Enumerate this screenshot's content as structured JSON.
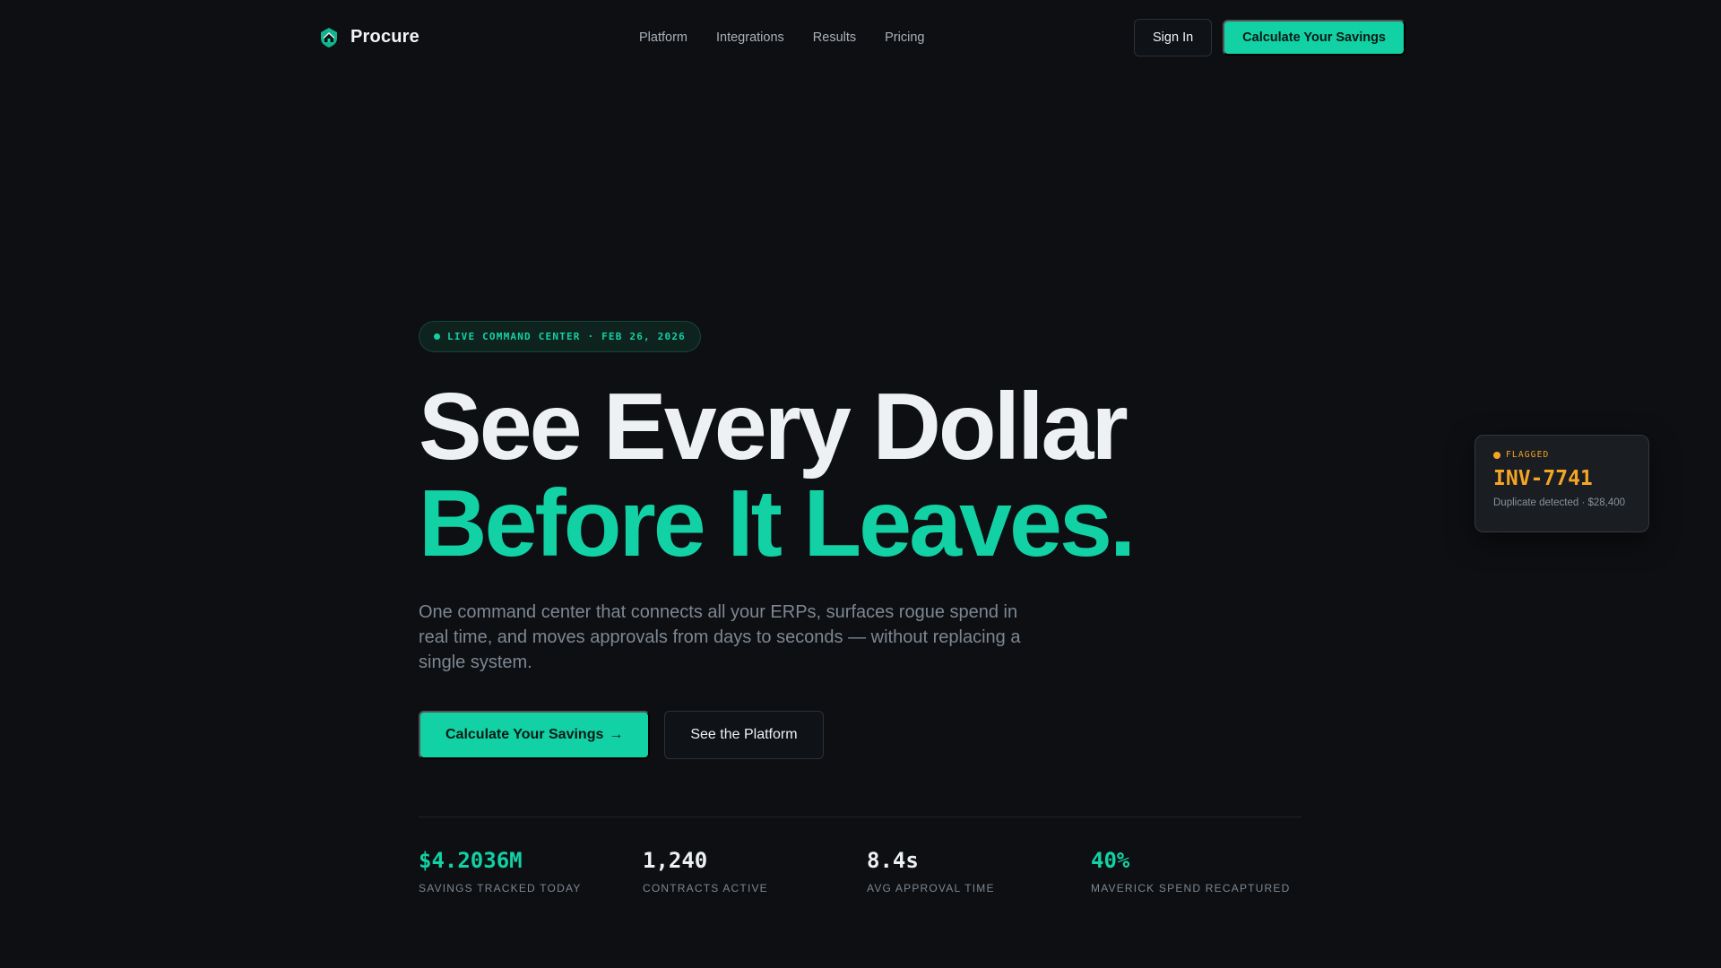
{
  "brand": {
    "name": "Procure",
    "logo_icon": "house-shield-icon"
  },
  "nav": {
    "links": [
      "Platform",
      "Integrations",
      "Results",
      "Pricing"
    ],
    "sign_in": "Sign In",
    "cta": "Calculate Your Savings"
  },
  "hero": {
    "badge": "LIVE COMMAND CENTER · FEB 26, 2026",
    "headline_line1": "See Every Dollar",
    "headline_line2": "Before It Leaves.",
    "subcopy": "One command center that connects all your ERPs, surfaces rogue spend in real time, and moves approvals from days to seconds — without replacing a single system.",
    "primary_cta": "Calculate Your Savings",
    "primary_cta_arrow": "→",
    "secondary_cta": "See the Platform"
  },
  "stats": [
    {
      "value": "$4.2036M",
      "label": "SAVINGS TRACKED TODAY",
      "accent": true
    },
    {
      "value": "1,240",
      "label": "CONTRACTS ACTIVE",
      "accent": false
    },
    {
      "value": "8.4s",
      "label": "AVG APPROVAL TIME",
      "accent": false
    },
    {
      "value": "40%",
      "label": "MAVERICK SPEND RECAPTURED",
      "accent": true
    }
  ],
  "flag_card": {
    "status": "FLAGGED",
    "invoice_id": "INV-7741",
    "note": "Duplicate detected · $28,400"
  },
  "colors": {
    "background": "#0d0f12",
    "accent": "#12d1a4",
    "warning": "#f5a524",
    "muted_text": "#7d8792"
  }
}
